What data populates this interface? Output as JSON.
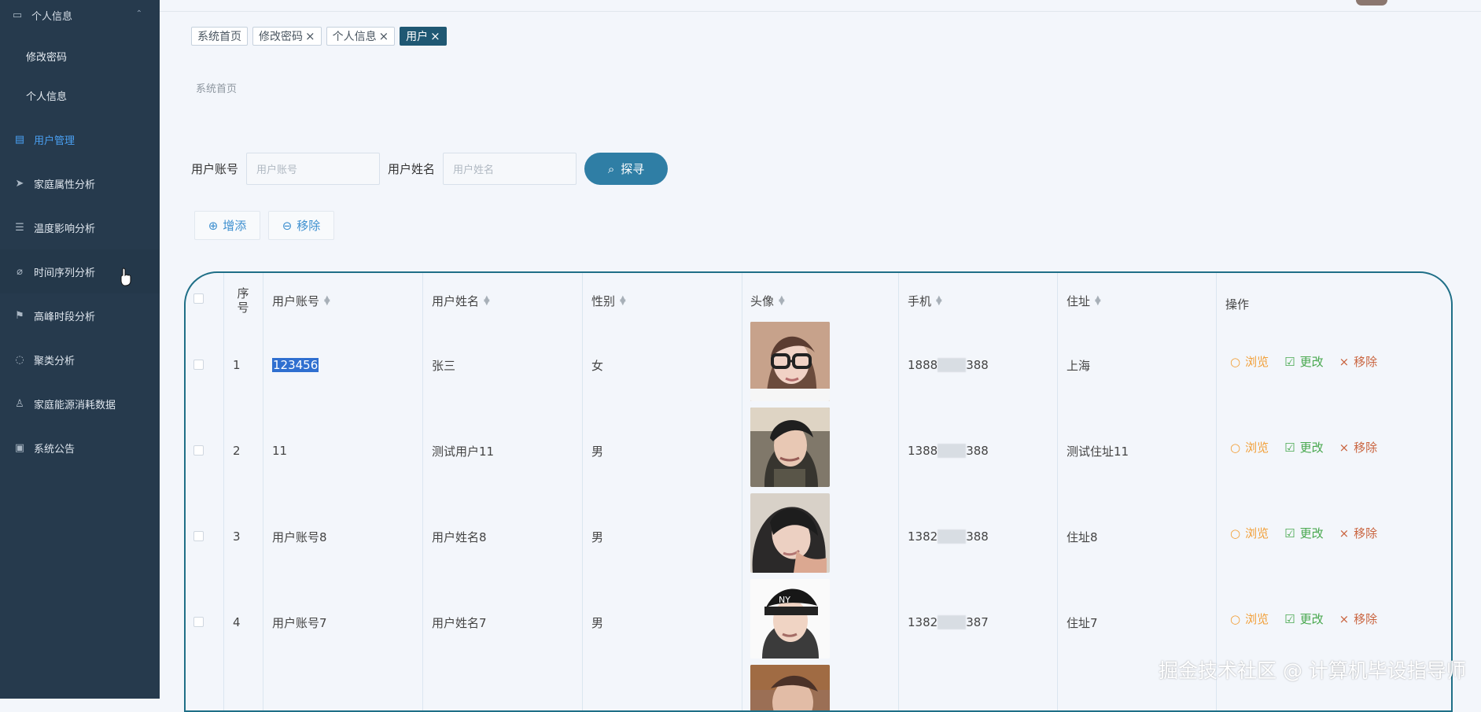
{
  "sidebar": {
    "section": "个人信息",
    "sub_items": [
      "修改密码",
      "个人信息"
    ],
    "items": [
      {
        "label": "用户管理",
        "active": true
      },
      {
        "label": "家庭属性分析"
      },
      {
        "label": "温度影响分析"
      },
      {
        "label": "时间序列分析"
      },
      {
        "label": "高峰时段分析"
      },
      {
        "label": "聚类分析"
      },
      {
        "label": "家庭能源消耗数据"
      },
      {
        "label": "系统公告"
      }
    ]
  },
  "tabs": [
    {
      "label": "系统首页",
      "closable": false
    },
    {
      "label": "修改密码",
      "closable": true
    },
    {
      "label": "个人信息",
      "closable": true
    },
    {
      "label": "用户",
      "closable": true,
      "active": true
    }
  ],
  "breadcrumb": "系统首页",
  "search": {
    "account_label": "用户账号",
    "account_placeholder": "用户账号",
    "name_label": "用户姓名",
    "name_placeholder": "用户姓名",
    "button_label": "探寻"
  },
  "toolbar": {
    "add_label": "增添",
    "remove_label": "移除"
  },
  "table": {
    "headers": [
      "序号",
      "用户账号",
      "用户姓名",
      "性别",
      "头像",
      "手机",
      "住址",
      "操作"
    ],
    "rows": [
      {
        "index": "1",
        "account": "123456",
        "name": "张三",
        "gender": "女",
        "phone_start": "1888",
        "phone_end": "388",
        "address": "上海"
      },
      {
        "index": "2",
        "account": "11",
        "name": "测试用户11",
        "gender": "男",
        "phone_start": "1388",
        "phone_end": "388",
        "address": "测试住址11"
      },
      {
        "index": "3",
        "account": "用户账号8",
        "name": "用户姓名8",
        "gender": "男",
        "phone_start": "1382",
        "phone_end": "388",
        "address": "住址8"
      },
      {
        "index": "4",
        "account": "用户账号7",
        "name": "用户姓名7",
        "gender": "男",
        "phone_start": "1382",
        "phone_end": "387",
        "address": "住址7"
      }
    ],
    "actions": {
      "view": "浏览",
      "edit": "更改",
      "delete": "移除"
    }
  },
  "watermark": "掘金技术社区 @ 计算机毕设指导师",
  "colors": {
    "sidebar": "#263a4d",
    "accent": "#2f7ea5",
    "active_tab": "#1f5873",
    "selection": "#2f6fd0"
  }
}
